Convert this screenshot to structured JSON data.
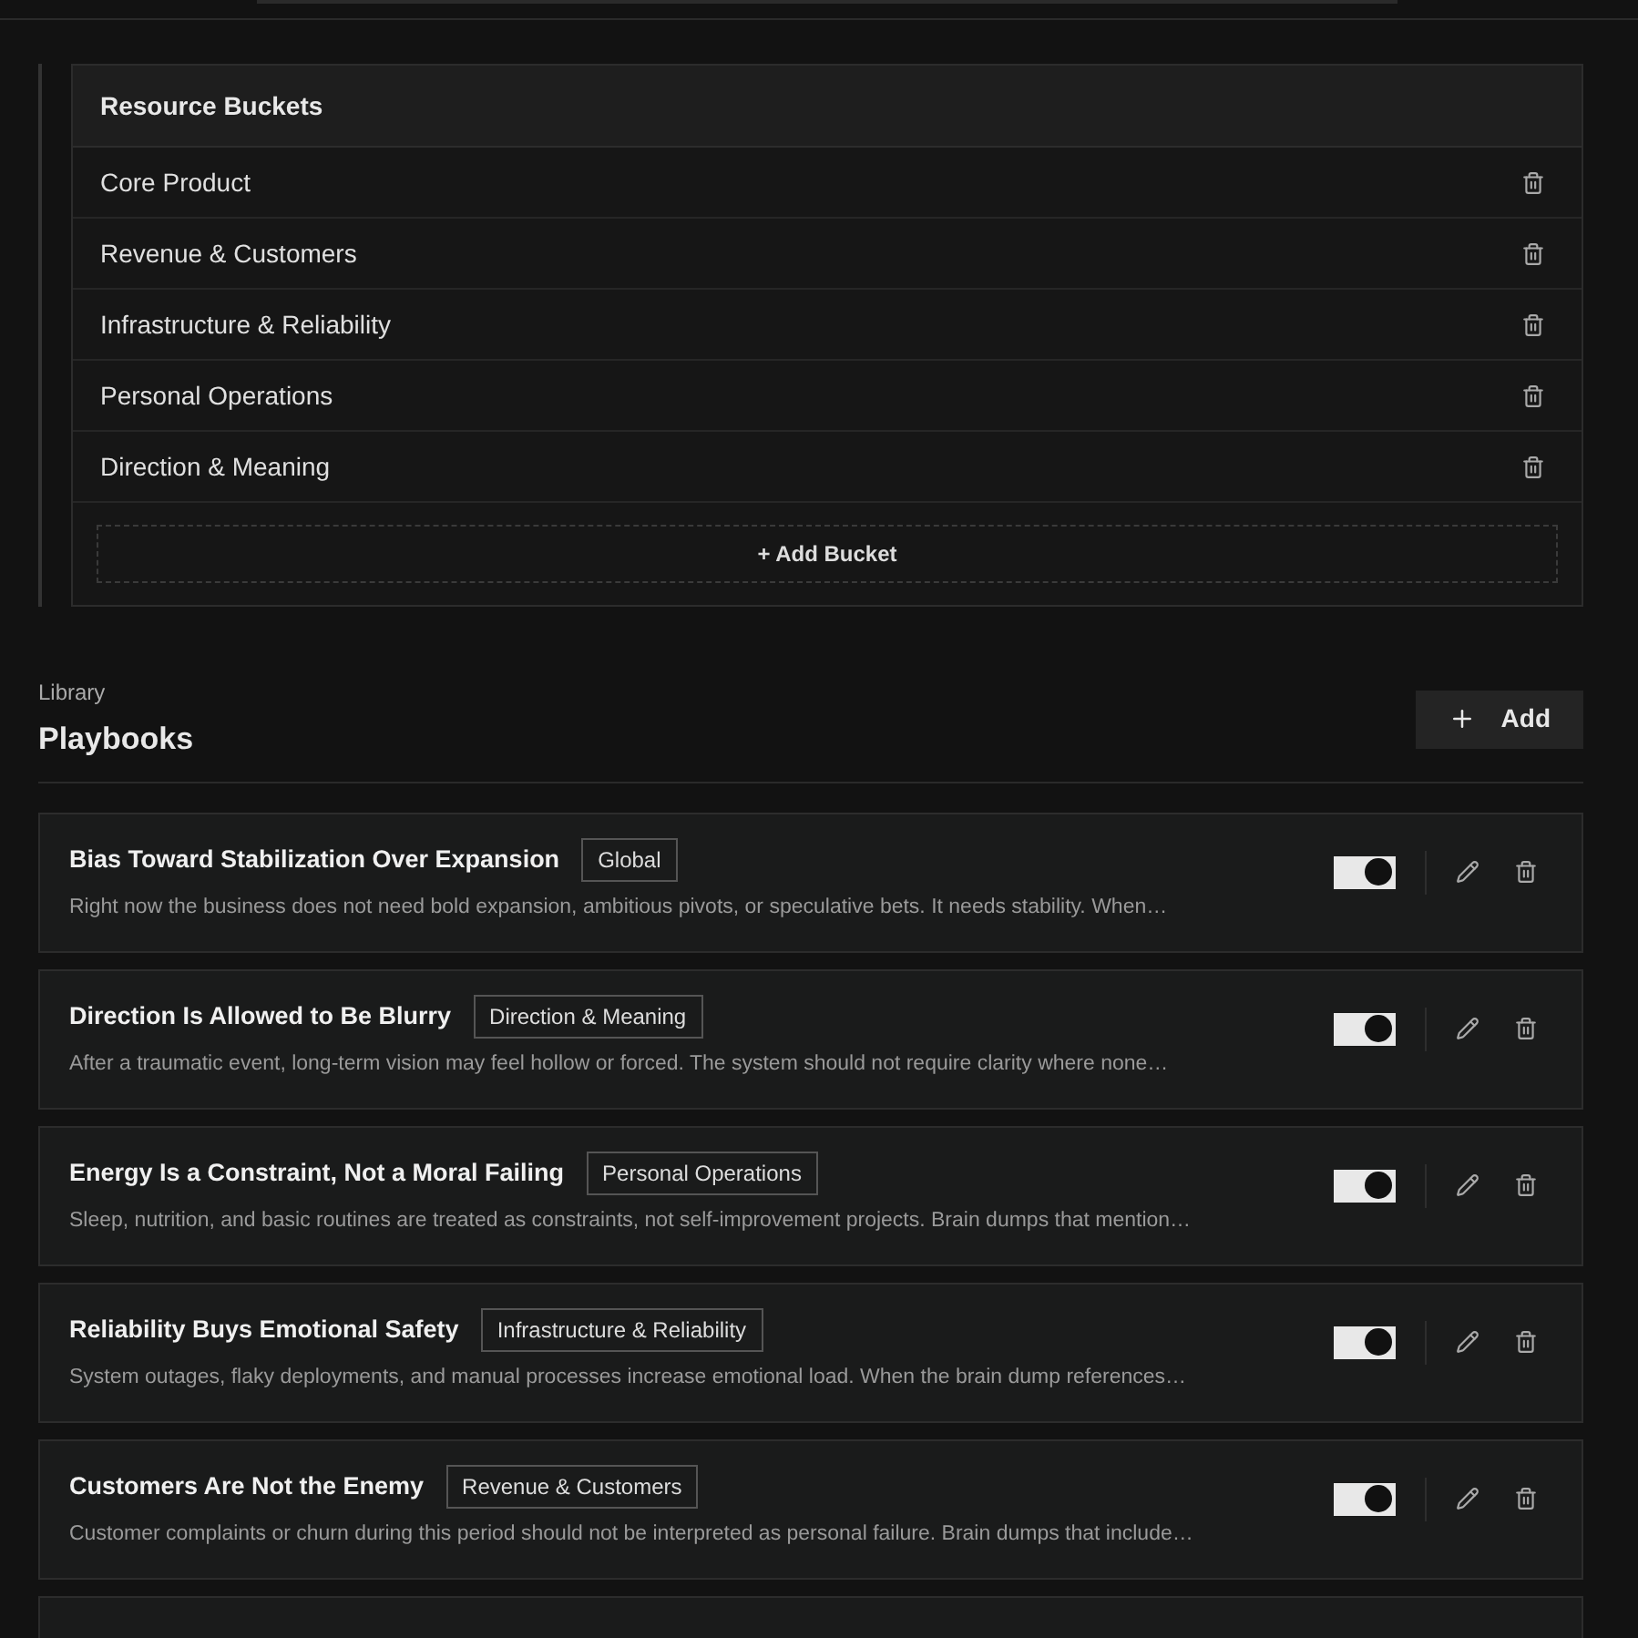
{
  "buckets": {
    "title": "Resource Buckets",
    "items": [
      {
        "name": "Core Product"
      },
      {
        "name": "Revenue & Customers"
      },
      {
        "name": "Infrastructure & Reliability"
      },
      {
        "name": "Personal Operations"
      },
      {
        "name": "Direction & Meaning"
      }
    ],
    "add_label": "+ Add Bucket"
  },
  "library": {
    "eyebrow": "Library",
    "title": "Playbooks",
    "add_button": "Add"
  },
  "playbooks": [
    {
      "title": "Bias Toward Stabilization Over Expansion",
      "tag": "Global",
      "description": "Right now the business does not need bold expansion, ambitious pivots, or speculative bets. It needs stability. When…",
      "on": true
    },
    {
      "title": "Direction Is Allowed to Be Blurry",
      "tag": "Direction & Meaning",
      "description": "After a traumatic event, long-term vision may feel hollow or forced. The system should not require clarity where none…",
      "on": true
    },
    {
      "title": "Energy Is a Constraint, Not a Moral Failing",
      "tag": "Personal Operations",
      "description": "Sleep, nutrition, and basic routines are treated as constraints, not self-improvement projects. Brain dumps that mention…",
      "on": true
    },
    {
      "title": "Reliability Buys Emotional Safety",
      "tag": "Infrastructure & Reliability",
      "description": "System outages, flaky deployments, and manual processes increase emotional load. When the brain dump references…",
      "on": true
    },
    {
      "title": "Customers Are Not the Enemy",
      "tag": "Revenue & Customers",
      "description": "Customer complaints or churn during this period should not be interpreted as personal failure. Brain dumps that include…",
      "on": true
    }
  ]
}
